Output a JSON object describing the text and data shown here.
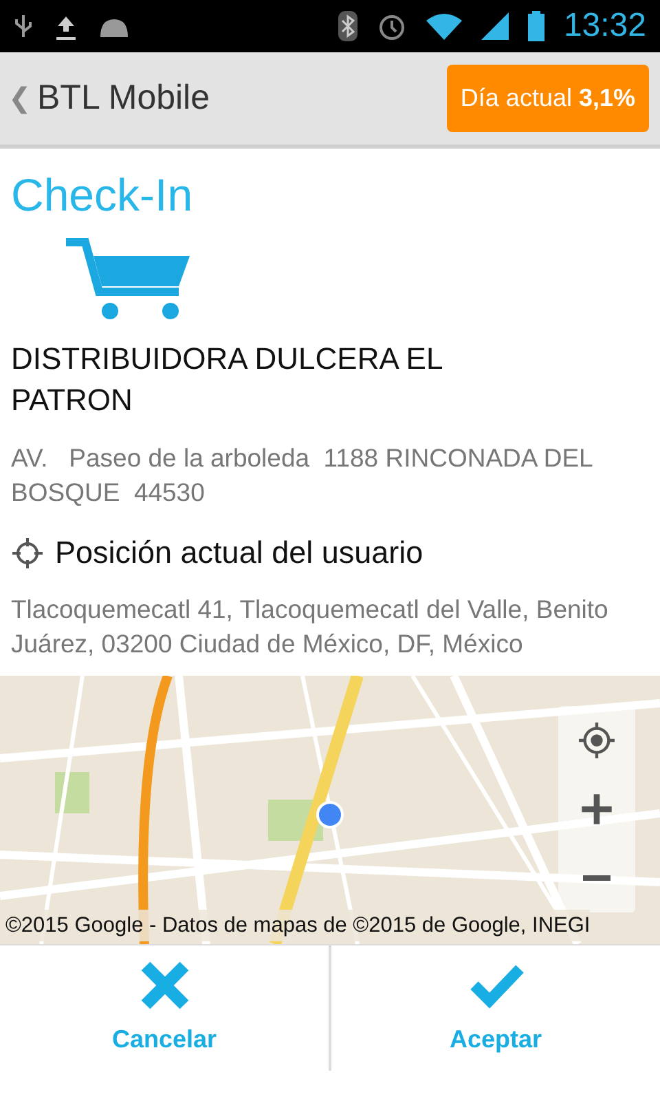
{
  "status_bar": {
    "time": "13:32"
  },
  "action_bar": {
    "back": "❮",
    "title": "BTL Mobile",
    "badge": "Día actual **3,1%**"
  },
  "screen_title": "Check-In",
  "store": {
    "name": "DISTRIBUIDORA DULCERA EL PATRON",
    "address": "AV.   Paseo de la arboleda  1188 RINCONADA DEL BOSQUE  44530"
  },
  "position": {
    "heading": "Posición actual del usuario",
    "address": "Tlacoquemecatl 41, Tlacoquemecatl del Valle, Benito Juárez, 03200 Ciudad de México, DF, México"
  },
  "map": {
    "attribution": "©2015 Google - Datos de mapas de ©2015 de Google, INEGI",
    "controls": [
      {
        "kind": "locate"
      },
      {
        "kind": "zoom_in"
      },
      {
        "kind": "zoom_out"
      }
    ]
  },
  "buttons": [
    {
      "kind": "cancel",
      "label": "Cancelar"
    },
    {
      "kind": "accept",
      "label": "Aceptar"
    }
  ]
}
